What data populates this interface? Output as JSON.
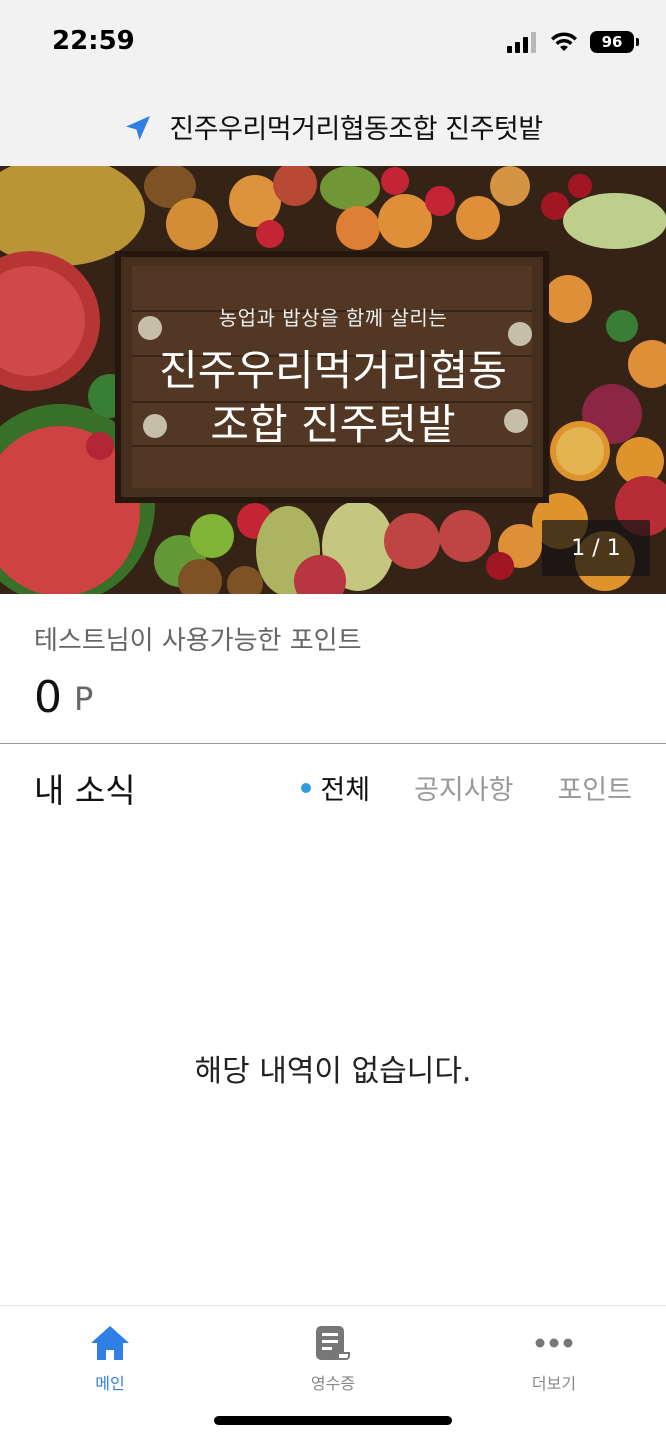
{
  "status_bar": {
    "time": "22:59",
    "battery": "96"
  },
  "header": {
    "title": "진주우리먹거리협동조합 진주텃밭",
    "icon": "location-arrow-icon"
  },
  "banner": {
    "subtitle": "농업과 밥상을 함께 살리는",
    "title_line1": "진주우리먹거리협동",
    "title_line2": "조합 진주텃밭",
    "page_indicator": "1 / 1"
  },
  "points": {
    "label": "테스트님이 사용가능한 포인트",
    "value": "0",
    "unit": "P"
  },
  "news": {
    "title": "내 소식",
    "tabs": [
      {
        "label": "전체",
        "active": true
      },
      {
        "label": "공지사항",
        "active": false
      },
      {
        "label": "포인트",
        "active": false
      }
    ],
    "empty_message": "해당 내역이 없습니다."
  },
  "bottom_nav": {
    "items": [
      {
        "label": "메인",
        "icon": "home-icon",
        "active": true
      },
      {
        "label": "영수증",
        "icon": "receipt-icon",
        "active": false
      },
      {
        "label": "더보기",
        "icon": "more-icon",
        "active": false
      }
    ]
  },
  "colors": {
    "accent": "#2f7fe6",
    "tab_dot": "#2f9be3",
    "header_bg": "#f2f2f2"
  }
}
